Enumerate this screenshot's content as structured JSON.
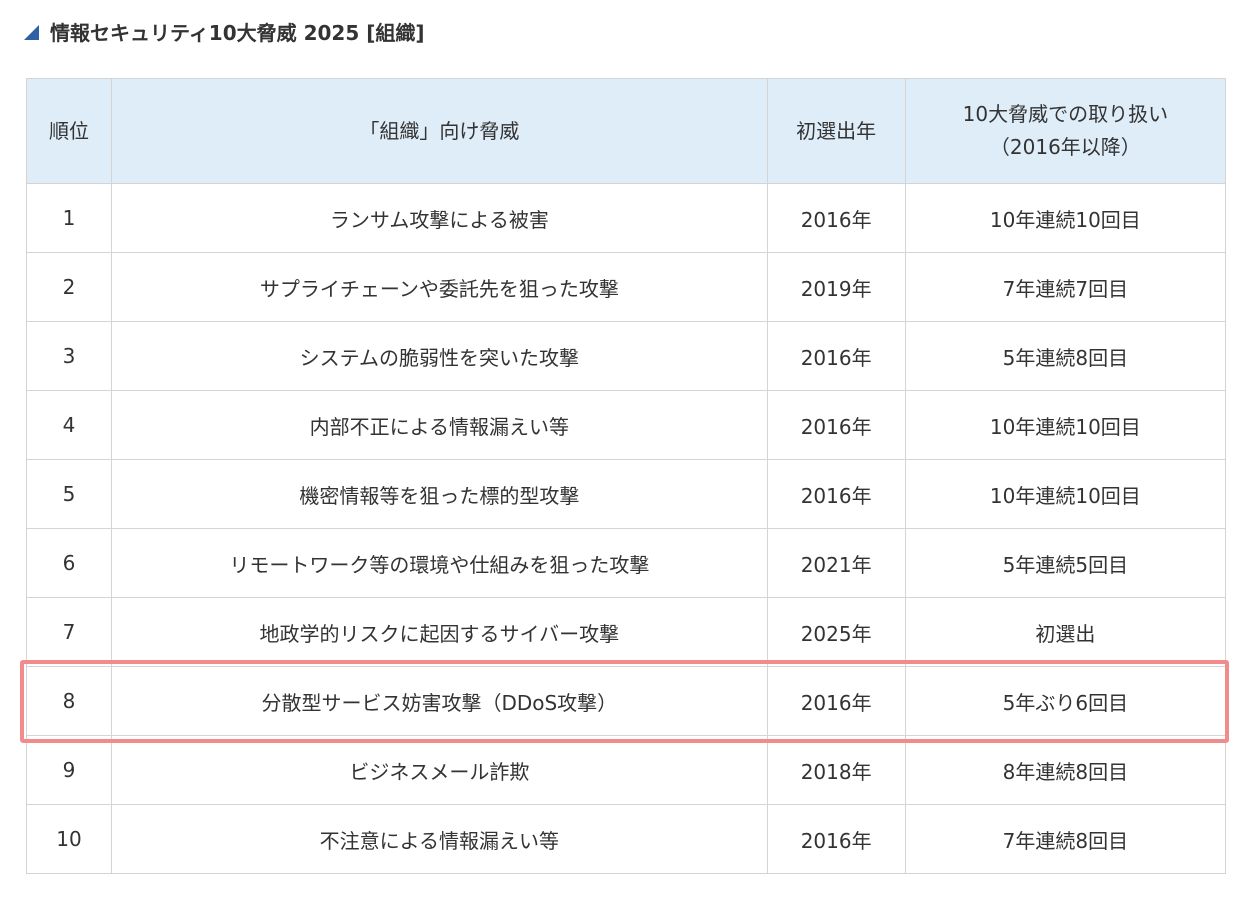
{
  "heading": {
    "title": "情報セキュリティ10大脅威 2025 [組織]",
    "marker_icon": "triangle-marker-icon",
    "marker_color": "#2f5fa8"
  },
  "table": {
    "header_bg": "#dfedf8",
    "headers": {
      "rank": "順位",
      "threat": "「組織」向け脅威",
      "first_selected": "初選出年",
      "handling_line1": "10大脅威での取り扱い",
      "handling_line2": "（2016年以降）"
    },
    "rows": [
      {
        "rank": "1",
        "threat": "ランサム攻撃による被害",
        "first_selected": "2016年",
        "handling": "10年連続10回目"
      },
      {
        "rank": "2",
        "threat": "サプライチェーンや委託先を狙った攻撃",
        "first_selected": "2019年",
        "handling": "7年連続7回目"
      },
      {
        "rank": "3",
        "threat": "システムの脆弱性を突いた攻撃",
        "first_selected": "2016年",
        "handling": "5年連続8回目"
      },
      {
        "rank": "4",
        "threat": "内部不正による情報漏えい等",
        "first_selected": "2016年",
        "handling": "10年連続10回目"
      },
      {
        "rank": "5",
        "threat": "機密情報等を狙った標的型攻撃",
        "first_selected": "2016年",
        "handling": "10年連続10回目"
      },
      {
        "rank": "6",
        "threat": "リモートワーク等の環境や仕組みを狙った攻撃",
        "first_selected": "2021年",
        "handling": "5年連続5回目"
      },
      {
        "rank": "7",
        "threat": "地政学的リスクに起因するサイバー攻撃",
        "first_selected": "2025年",
        "handling": "初選出"
      },
      {
        "rank": "8",
        "threat": "分散型サービス妨害攻撃（DDoS攻撃）",
        "first_selected": "2016年",
        "handling": "5年ぶり6回目"
      },
      {
        "rank": "9",
        "threat": "ビジネスメール詐欺",
        "first_selected": "2018年",
        "handling": "8年連続8回目"
      },
      {
        "rank": "10",
        "threat": "不注意による情報漏えい等",
        "first_selected": "2016年",
        "handling": "7年連続8回目"
      }
    ],
    "highlighted_rank": "8",
    "highlight_color": "#f28b8b"
  }
}
